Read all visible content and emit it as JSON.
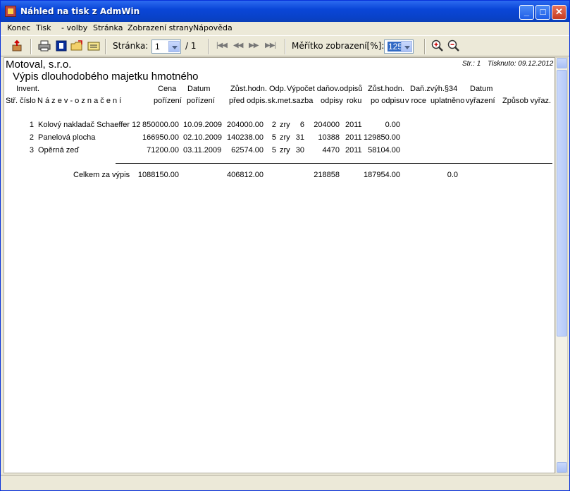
{
  "window": {
    "title": "Náhled na tisk z AdmWin",
    "min_label": "_",
    "max_label": "□",
    "close_label": "✕"
  },
  "menu": [
    "Konec",
    "Tisk",
    "- volby",
    "Stránka",
    "Zobrazení strany",
    "Nápověda"
  ],
  "toolbar": {
    "page_label": "Stránka:",
    "page_value": "1",
    "page_total": "/ 1",
    "zoom_label": "Měřítko zobrazení[%]:",
    "zoom_value": "125",
    "icons": [
      "exit-icon",
      "printer-icon",
      "settings-icon",
      "open-folder-icon",
      "email-icon",
      "first-page-icon",
      "prev-page-icon",
      "next-page-icon",
      "last-page-icon",
      "zoom-in-icon",
      "zoom-out-icon"
    ]
  },
  "report": {
    "company": "Motoval, s.r.o.",
    "title": "Výpis dlouhodobého majetku hmotného",
    "page_info": "Str.: 1",
    "printed": "Tisknuto: 09.12.2012",
    "headers_top": [
      "Invent.",
      "Cena",
      "Datum",
      "Zůst.hodn.",
      "Odp.",
      "Výpočet daňov.odpisů",
      "Zůst.hodn.",
      "Daň.zvýh.§34",
      "Datum"
    ],
    "headers_bottom": [
      "Stř. číslo",
      "N á z e v - o z n a č e n í",
      "pořízení",
      "pořízení",
      "před odpis.",
      "sk.",
      "met.",
      "sazba",
      "odpisy",
      "roku",
      "po odpisu",
      "v roce",
      "uplatněno",
      "vyřazení",
      "Způsob vyřaz."
    ],
    "rows": [
      {
        "num": "1",
        "name": "Kolový nakladač Schaeffer 12",
        "price": "850000.00",
        "date": "10.09.2009",
        "before": "204000.00",
        "group": "2",
        "method": "zry",
        "rate": "6",
        "depr": "204000",
        "year": "2011",
        "after": "0.00"
      },
      {
        "num": "2",
        "name": "Panelová plocha",
        "price": "166950.00",
        "date": "02.10.2009",
        "before": "140238.00",
        "group": "5",
        "method": "zry",
        "rate": "31",
        "depr": "10388",
        "year": "2011",
        "after": "129850.00"
      },
      {
        "num": "3",
        "name": "Opěrná zeď",
        "price": "71200.00",
        "date": "03.11.2009",
        "before": "62574.00",
        "group": "5",
        "method": "zry",
        "rate": "30",
        "depr": "4470",
        "year": "2011",
        "after": "58104.00"
      }
    ],
    "totals": {
      "label": "Celkem za výpis",
      "price": "1088150.00",
      "before": "406812.00",
      "depr": "218858",
      "after": "187954.00",
      "tax": "0.0"
    }
  }
}
